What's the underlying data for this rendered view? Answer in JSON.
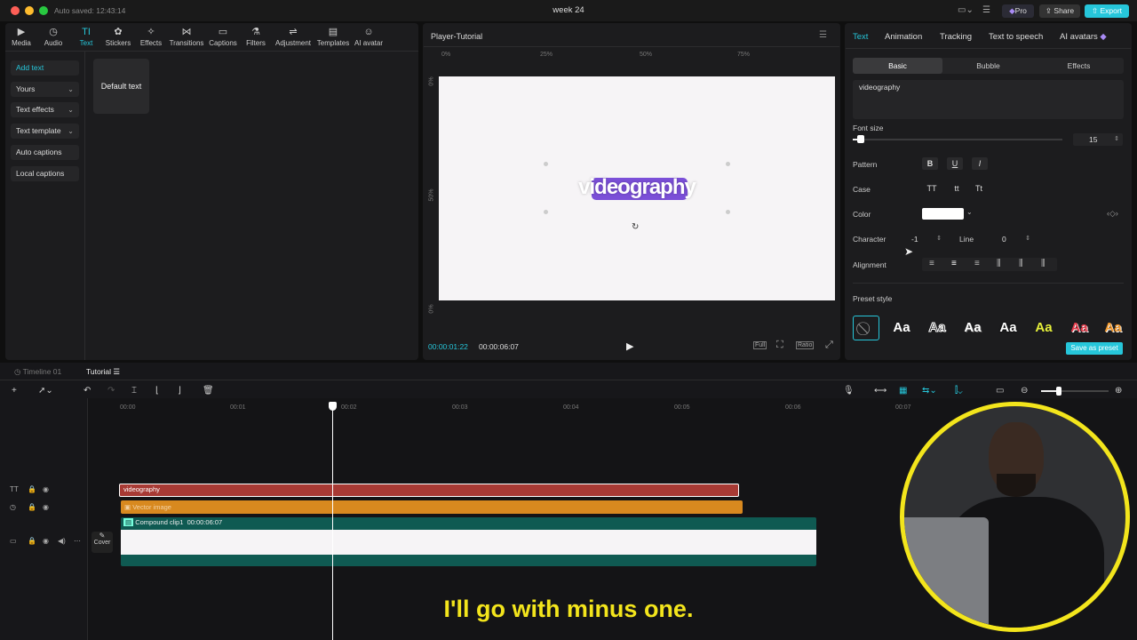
{
  "titlebar": {
    "autosave": "Auto saved: 12:43:14",
    "title": "week 24",
    "pro_label": "Pro",
    "share_label": "Share",
    "export_label": "Export"
  },
  "toolbar": {
    "items": [
      {
        "label": "Media",
        "icon": "▶"
      },
      {
        "label": "Audio",
        "icon": "◷"
      },
      {
        "label": "Text",
        "icon": "TI"
      },
      {
        "label": "Stickers",
        "icon": "✿"
      },
      {
        "label": "Effects",
        "icon": "✧"
      },
      {
        "label": "Transitions",
        "icon": "⋈"
      },
      {
        "label": "Captions",
        "icon": "▭"
      },
      {
        "label": "Filters",
        "icon": "⚗"
      },
      {
        "label": "Adjustment",
        "icon": "⇌"
      },
      {
        "label": "Templates",
        "icon": "▤"
      },
      {
        "label": "AI avatar",
        "icon": "☺"
      }
    ]
  },
  "leftnav": {
    "add_text": "Add text",
    "yours": "Yours",
    "text_effects": "Text effects",
    "text_template": "Text template",
    "auto_captions": "Auto captions",
    "local_captions": "Local captions",
    "default_text": "Default text"
  },
  "player": {
    "title": "Player-Tutorial",
    "ruler": [
      "0%",
      "25%",
      "50%",
      "75%"
    ],
    "vruler": [
      "0%",
      "50%",
      "0%"
    ],
    "canvas_text": "videography",
    "current_time": "00:00:01:22",
    "total_time": "00:00:06:07",
    "full_label": "Full",
    "ratio_label": "Ratio"
  },
  "inspector": {
    "tabs": [
      "Text",
      "Animation",
      "Tracking",
      "Text to speech",
      "AI avatars"
    ],
    "subtabs": [
      "Basic",
      "Bubble",
      "Effects"
    ],
    "text_value": "videography",
    "font_size_label": "Font size",
    "font_size_value": "15",
    "font_size_fraction": 0.04,
    "pattern_label": "Pattern",
    "case_label": "Case",
    "case_options": [
      "TT",
      "tt",
      "Tt"
    ],
    "color_label": "Color",
    "color_value": "#ffffff",
    "character_label": "Character",
    "character_value": "-1",
    "line_label": "Line",
    "line_value": "0",
    "alignment_label": "Alignment",
    "preset_label": "Preset style",
    "preset_sample": "Aa",
    "save_preset": "Save as preset"
  },
  "timeline": {
    "tab1": "Timeline 01",
    "tab2": "Tutorial",
    "ticks": [
      "00:00",
      "00:01",
      "00:02",
      "00:03",
      "00:04",
      "00:05",
      "00:06",
      "00:07"
    ],
    "clip_text": "videography",
    "clip_image": "Vector image",
    "compound_label": "Compound clip1",
    "compound_duration": "00:00:06:07",
    "cover_label": "Cover"
  },
  "caption": "I'll go with minus one.",
  "colors": {
    "accent": "#26c6da",
    "highlight": "#7b4fd8",
    "text_clip": "#a83a34",
    "image_clip": "#d8891f",
    "compound_clip": "#0f5a52",
    "avatar_ring": "#f3e51c"
  }
}
